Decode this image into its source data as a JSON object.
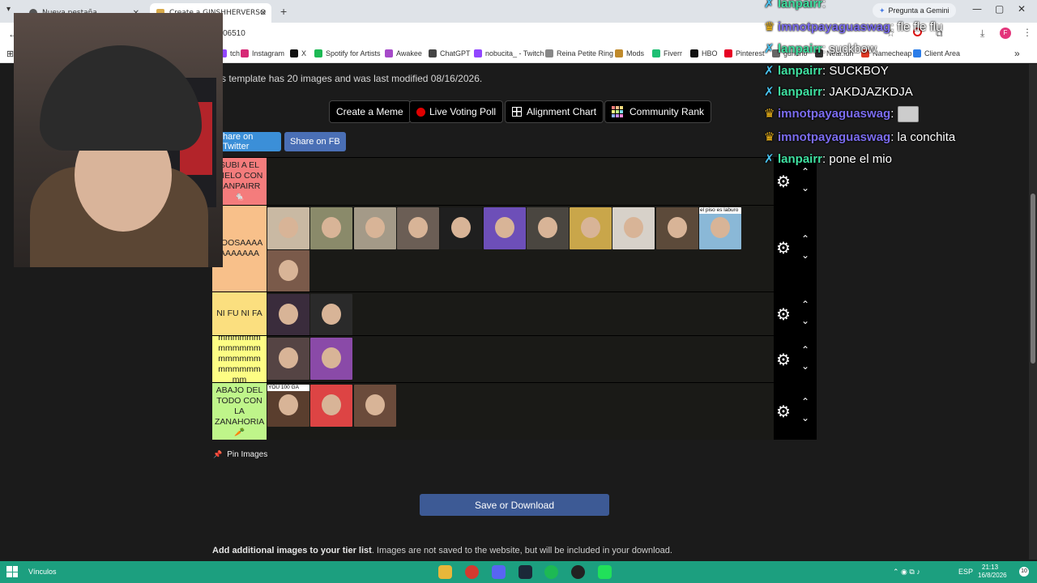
{
  "browser": {
    "tabs": [
      {
        "title": "Nueva pestaña",
        "active": false
      },
      {
        "title": "Create a GINSHHERVERSO",
        "active": true
      }
    ],
    "new_tab": "+",
    "url_fragment": "06510",
    "window_controls": [
      "—",
      "▢",
      "✕"
    ],
    "gemini_button": "Pregunta a Gemini",
    "bookmarks": [
      {
        "label": "tch",
        "color": "#9146ff"
      },
      {
        "label": "Instagram",
        "color": "#d62976"
      },
      {
        "label": "X",
        "color": "#111111"
      },
      {
        "label": "Spotify for Artists",
        "color": "#1db954"
      },
      {
        "label": "Awakee",
        "color": "#a64ac9"
      },
      {
        "label": "ChatGPT",
        "color": "#444444"
      },
      {
        "label": "nobucita_ - Twitch",
        "color": "#9146ff"
      },
      {
        "label": "Reina Petite Ring",
        "color": "#888888"
      },
      {
        "label": "Mods",
        "color": "#c08a2b"
      },
      {
        "label": "Fiverr",
        "color": "#1dbf73"
      },
      {
        "label": "HBO",
        "color": "#111111"
      },
      {
        "label": "Pinterest",
        "color": "#e60023"
      },
      {
        "label": "guncho",
        "color": "#666666"
      },
      {
        "label": "Neal.fun",
        "color": "#333333"
      },
      {
        "label": "Namecheap",
        "color": "#de3723"
      },
      {
        "label": "Client Area",
        "color": "#2b7de9"
      }
    ],
    "bookmarks_overflow": "»"
  },
  "page": {
    "template_info": "s template has 20 images and was last modified 08/16/2026.",
    "buttons": {
      "create_meme": "Create a Meme",
      "live_voting": "Live Voting Poll",
      "alignment_chart": "Alignment Chart",
      "community_rank": "Community Rank"
    },
    "share": {
      "twitter": "hare on Twitter",
      "fb": "Share on FB"
    },
    "tiers": [
      {
        "label": "SUBI A EL CIELO CON LANPAIRR 🐁",
        "color": "#f47c7c",
        "count": 0
      },
      {
        "label": "TOOSAAAAAAAAAAA",
        "color": "#f8c08a",
        "count": 12,
        "thumb_caption": "el piso es laburo"
      },
      {
        "label": "NI FU NI FA",
        "color": "#fbdf7f",
        "count": 2
      },
      {
        "label": "mmmmmmmmmmmmmmmmmmmmmmmmmm",
        "color": "#fdfd84",
        "count": 2
      },
      {
        "label": "ABAJO DEL TODO CON LA ZANAHORIA 🥕",
        "color": "#bff58a",
        "count": 3,
        "thumb_caption": "YOU 100 GA"
      }
    ],
    "controls": {
      "gear": "⚙",
      "up": "⌃",
      "down": "⌄"
    },
    "pin_images": "Pin Images",
    "save_button": "Save or Download",
    "add_images_bold": "Add additional images to your tier list",
    "add_images_rest": ". Images are not saved to the website, but will be included in your download."
  },
  "chat": [
    {
      "user": "lanpairr",
      "text": "",
      "color": "#3fe0a0",
      "badge": "sword"
    },
    {
      "user": "imnotpayaguaswag",
      "text": "fle fle flu",
      "color": "#7b6cf0",
      "badge": "crown"
    },
    {
      "user": "lanpairr",
      "text": "suckbow",
      "color": "#3fe0a0",
      "badge": "sword"
    },
    {
      "user": "lanpairr",
      "text": "SUCKBOY",
      "color": "#3fe0a0",
      "badge": "sword"
    },
    {
      "user": "lanpairr",
      "text": "JAKDJAZKDJA",
      "color": "#3fe0a0",
      "badge": "sword"
    },
    {
      "user": "imnotpayaguaswag",
      "text": "",
      "color": "#7b6cf0",
      "badge": "crown",
      "emote": true
    },
    {
      "user": "imnotpayaguaswag",
      "text": "la conchita",
      "color": "#7b6cf0",
      "badge": "crown"
    },
    {
      "user": "lanpairr",
      "text": "pone el mio",
      "color": "#3fe0a0",
      "badge": "sword"
    }
  ],
  "taskbar": {
    "links_label": "Vínculos",
    "language": "ESP",
    "time": "21:13",
    "date": "16/8/2026",
    "notification_count": "10"
  }
}
